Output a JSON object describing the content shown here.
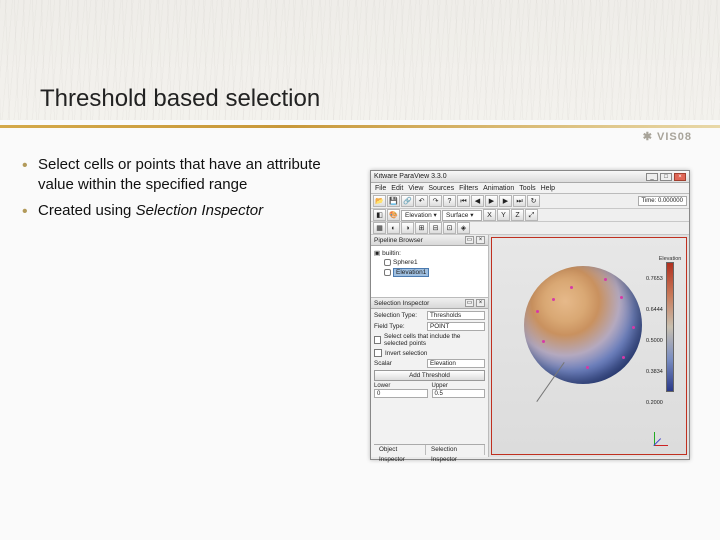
{
  "slide": {
    "title": "Threshold based selection",
    "logo": "VIS08",
    "bullets": [
      "Select cells or points that have an attribute value within the specified range",
      "Created using <i>Selection Inspector</i>"
    ],
    "b1a": "Select cells or points that have an attribute value within the specified range",
    "b2a": "Created using ",
    "b2b": "Selection Inspector"
  },
  "app": {
    "title": "Kitware ParaView 3.3.0",
    "menu": [
      "File",
      "Edit",
      "View",
      "Sources",
      "Filters",
      "Animation",
      "Tools",
      "Help"
    ],
    "time": "Time: 0.000000",
    "dropdowns": {
      "vector": "Elevation",
      "repr": "Surface"
    },
    "pipeline": {
      "header": "Pipeline Browser",
      "root": "builtin:",
      "nodes": [
        "Sphere1",
        "Elevation1"
      ]
    },
    "inspector": {
      "header": "Selection Inspector",
      "selType_l": "Selection Type:",
      "selType_v": "Thresholds",
      "fieldType_l": "Field Type:",
      "fieldType_v": "POINT",
      "chk1": "Select cells that include the selected points",
      "chk2": "Invert selection",
      "scalar_l": "Scalar",
      "scalar_v": "Elevation",
      "addBtn": "Add Threshold",
      "lower_l": "Lower",
      "lower_v": "0",
      "upper_l": "Upper",
      "upper_v": "0.5",
      "tabs": [
        "Object Inspector",
        "Selection Inspector"
      ]
    },
    "colorbar": {
      "title": "Elevation",
      "ticks": [
        "0.7653",
        "0.6444",
        "0.5000",
        "0.3834",
        "0.2000"
      ]
    }
  }
}
